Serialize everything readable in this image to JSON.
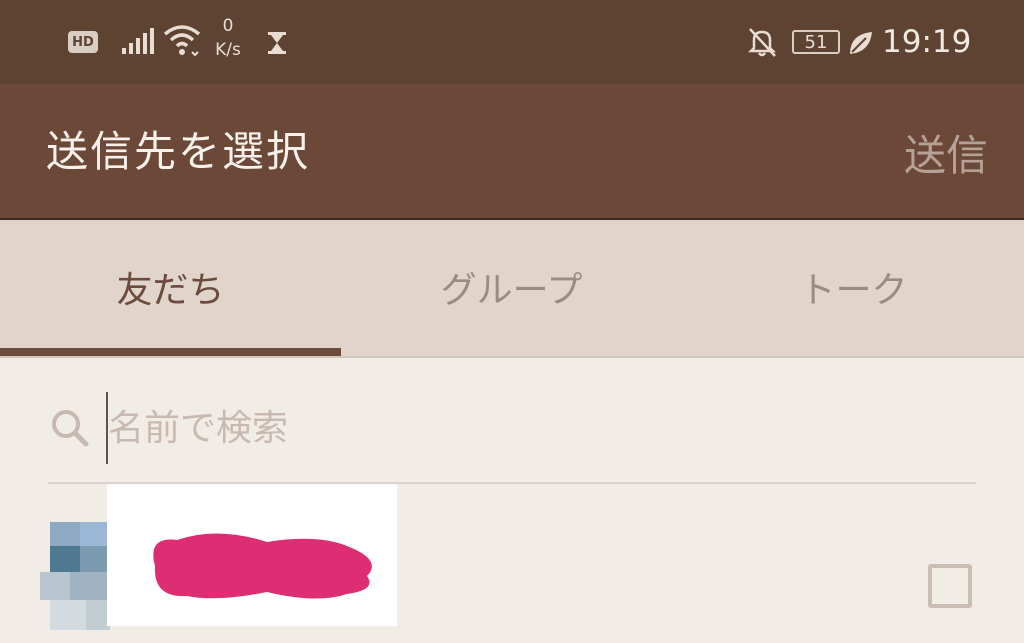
{
  "status_bar": {
    "hd_label": "HD",
    "net_speed_value": "0",
    "net_speed_unit": "K/s",
    "battery_level": "51",
    "time": "19:19",
    "icons": [
      "signal-icon",
      "wifi-icon",
      "hourglass-icon",
      "bell-off-icon",
      "battery-icon",
      "leaf-icon"
    ]
  },
  "app_bar": {
    "title": "送信先を選択",
    "send_label": "送信"
  },
  "tabs": [
    {
      "label": "友だち",
      "active": true
    },
    {
      "label": "グループ",
      "active": false
    },
    {
      "label": "トーク",
      "active": false
    }
  ],
  "search": {
    "placeholder": "名前で検索",
    "value": ""
  },
  "friends": [
    {
      "name_redacted": true,
      "checked": false
    }
  ],
  "colors": {
    "status_bar_bg": "#5e4333",
    "app_bar_bg": "#6c4838",
    "tab_bar_bg": "#e0d4cb",
    "tab_indicator": "#6d4b3c",
    "content_bg": "#f2ece6",
    "redaction": "#dd2e74"
  }
}
